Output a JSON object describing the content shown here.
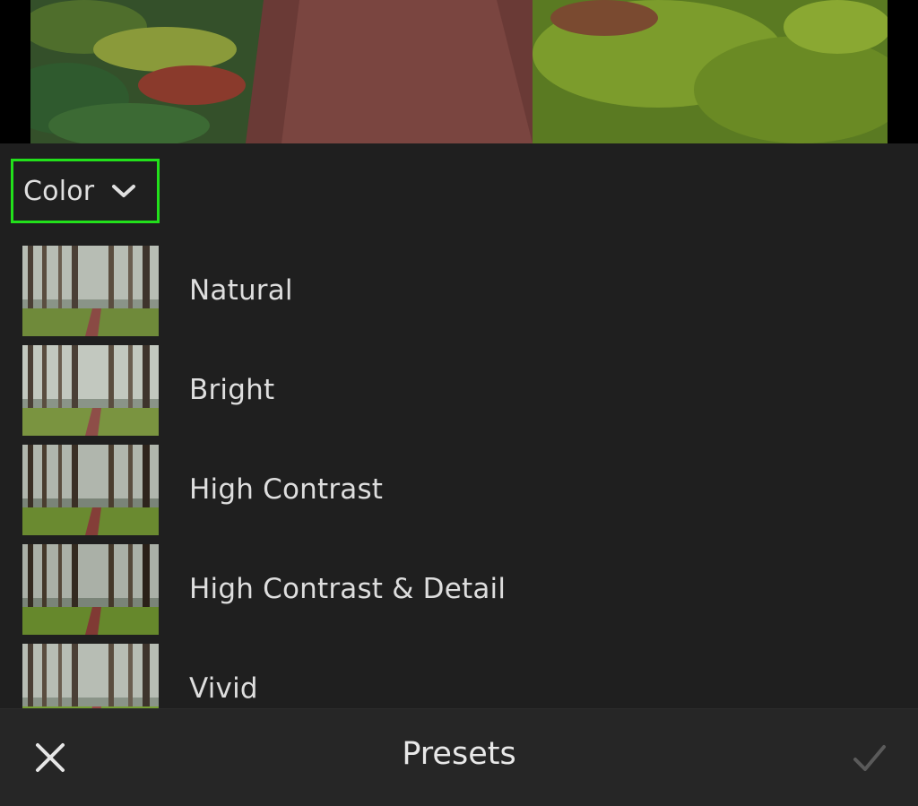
{
  "panel": {
    "group_select": {
      "label": "Color",
      "icon": "chevron-down-icon"
    },
    "presets": [
      {
        "name": "Natural"
      },
      {
        "name": "Bright"
      },
      {
        "name": "High Contrast"
      },
      {
        "name": "High Contrast & Detail"
      },
      {
        "name": "Vivid"
      }
    ]
  },
  "toolbar": {
    "title": "Presets",
    "close_icon": "close-icon",
    "confirm_icon": "checkmark-icon"
  },
  "colors": {
    "highlight": "#22e01b",
    "background": "#1f1f1f",
    "toolbar": "#262626"
  }
}
